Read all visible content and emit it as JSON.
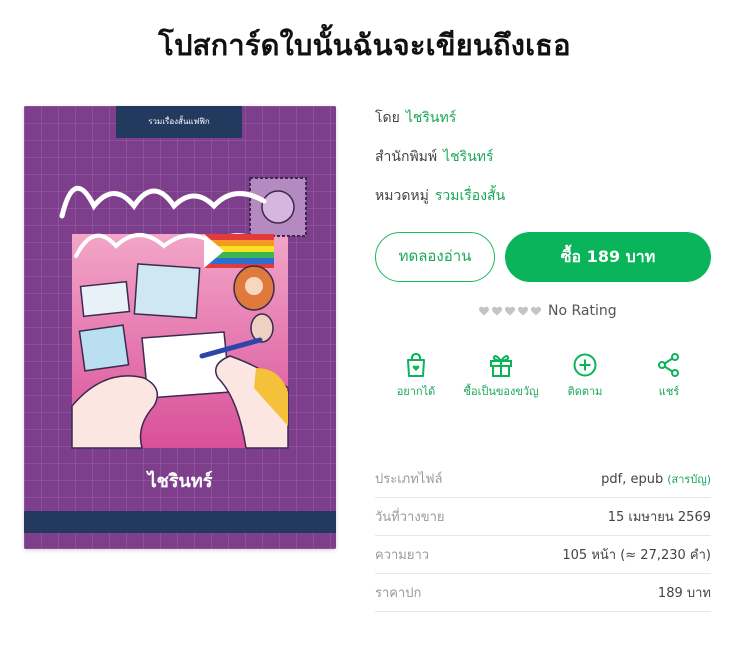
{
  "title": "โปสการ์ดใบนั้นฉันจะเขียนถึงเธอ",
  "cover": {
    "top_tag": "รวมเรื่องสั้นแฟฟิก",
    "title_art": "โปสการ์ดใบนั้นฉันจะเขียนถึงเธอ",
    "author": "ไชรินทร์"
  },
  "meta": {
    "author_label": "โดย",
    "author": "ไชรินทร์",
    "publisher_label": "สำนักพิมพ์",
    "publisher": "ไชรินทร์",
    "category_label": "หมวดหมู่",
    "category": "รวมเรื่องสั้น"
  },
  "buttons": {
    "sample": "ทดลองอ่าน",
    "buy": "ซื้อ 189 บาท"
  },
  "rating": {
    "text": "No Rating",
    "stars": 0,
    "max": 5
  },
  "actions": [
    {
      "label": "อยากได้",
      "icon": "wishlist-bag-icon"
    },
    {
      "label": "ซื้อเป็นของขวัญ",
      "icon": "gift-icon"
    },
    {
      "label": "ติดตาม",
      "icon": "plus-circle-icon"
    },
    {
      "label": "แชร์",
      "icon": "share-icon"
    }
  ],
  "details": [
    {
      "key": "ประเภทไฟล์",
      "value": "pdf, epub",
      "extra": "(สารบัญ)"
    },
    {
      "key": "วันที่วางขาย",
      "value": "15 เมษายน 2569"
    },
    {
      "key": "ความยาว",
      "value": "105 หน้า (≈ 27,230 คำ)"
    },
    {
      "key": "ราคาปก",
      "value": "189 บาท"
    }
  ],
  "colors": {
    "accent": "#09b45a",
    "cover_bg": "#7d3f8c",
    "cover_navy": "#233a5e"
  }
}
